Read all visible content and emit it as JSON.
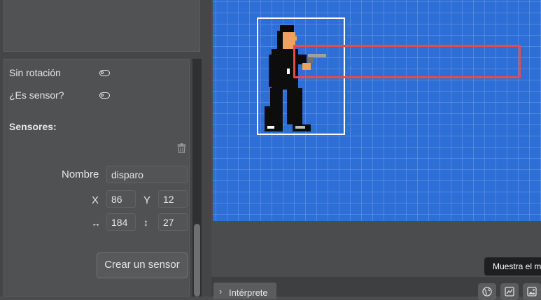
{
  "properties": {
    "no_rotation_label": "Sin rotación",
    "is_sensor_label": "¿Es sensor?",
    "sensors_heading": "Sensores:"
  },
  "sensor": {
    "name_label": "Nombre",
    "name_value": "disparo",
    "x_label": "X",
    "x_value": "86",
    "y_label": "Y",
    "y_value": "12",
    "width_label": "↔",
    "width_value": "184",
    "height_label": "↕",
    "height_value": "27"
  },
  "buttons": {
    "create_sensor": "Crear un sensor"
  },
  "bottom_bar": {
    "interpreter_tab": "Intérprete",
    "chevron": "›",
    "tooltip": "Muestra el m"
  },
  "icons": {
    "delete": "trash-icon",
    "globe": "globe-icon",
    "chart": "chart-icon",
    "image": "image-icon"
  },
  "colors": {
    "canvas_bg": "#2d6fd6",
    "sensor_outline": "#e84a4a",
    "selection_outline": "#ffffff"
  }
}
